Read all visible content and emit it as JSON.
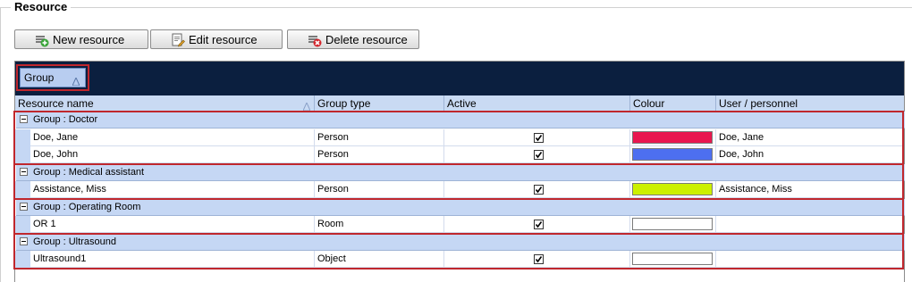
{
  "section_title": "Resource",
  "toolbar": {
    "new_label": "New resource",
    "edit_label": "Edit resource",
    "delete_label": "Delete resource"
  },
  "group_panel": {
    "chip_label": "Group"
  },
  "columns": {
    "resource_name": "Resource name",
    "group_type": "Group type",
    "active": "Active",
    "colour": "Colour",
    "user_personnel": "User / personnel"
  },
  "groups": [
    {
      "label": "Group : Doctor",
      "rows": [
        {
          "name": "Doe, Jane",
          "type": "Person",
          "active": true,
          "colour": "#e8174f",
          "user": "Doe, Jane"
        },
        {
          "name": "Doe, John",
          "type": "Person",
          "active": true,
          "colour": "#4d6ff0",
          "user": "Doe, John"
        }
      ]
    },
    {
      "label": "Group : Medical assistant",
      "rows": [
        {
          "name": "Assistance, Miss",
          "type": "Person",
          "active": true,
          "colour": "#ccf000",
          "user": "Assistance, Miss"
        }
      ]
    },
    {
      "label": "Group : Operating Room",
      "rows": [
        {
          "name": "OR 1",
          "type": "Room",
          "active": true,
          "colour": "#ffffff",
          "user": ""
        }
      ]
    },
    {
      "label": "Group : Ultrasound",
      "rows": [
        {
          "name": "Ultrasound1",
          "type": "Object",
          "active": true,
          "colour": "#ffffff",
          "user": ""
        }
      ]
    }
  ],
  "icons": {
    "new": "add-document-icon",
    "edit": "edit-document-icon",
    "delete": "delete-document-icon"
  },
  "colors": {
    "group_panel_bg": "#0b1f3f",
    "header_bg": "#c9daf3",
    "highlight_red": "#c0272d"
  }
}
